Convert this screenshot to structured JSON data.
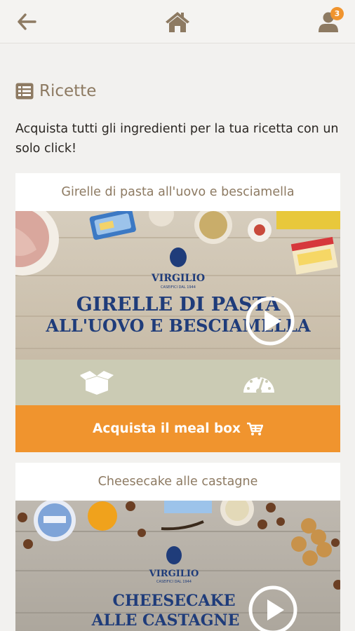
{
  "header": {
    "back_icon": "arrow-left-icon",
    "home_icon": "home-icon",
    "user_icon": "user-icon",
    "notification_count": "3"
  },
  "section": {
    "icon": "list-icon",
    "title": "Ricette",
    "intro": "Acquista tutti gli ingredienti per la tua ricetta con un solo click!"
  },
  "recipes": [
    {
      "title": "Girelle di pasta all'uovo e besciamella",
      "brand": "VIRGILIO",
      "brand_tagline": "CASEIFICI DAL 1944",
      "image_line1": "GIRELLE DI PASTA",
      "image_line2": "ALL'UOVO E BESCIAMELLA",
      "box_icon": "box-open-icon",
      "difficulty_icon": "gauge-icon",
      "buy_label": "Acquista il meal box",
      "cart_icon": "cart-icon"
    },
    {
      "title": "Cheesecake alle castagne",
      "brand": "VIRGILIO",
      "brand_tagline": "CASEIFICI DAL 1944",
      "image_line1": "CHEESECAKE",
      "image_line2": "ALLE CASTAGNE"
    }
  ],
  "colors": {
    "accent": "#f0942e",
    "title_brown": "#8d7a62",
    "info_bar": "#cbcbb4",
    "brand_blue": "#1f3c7a"
  }
}
